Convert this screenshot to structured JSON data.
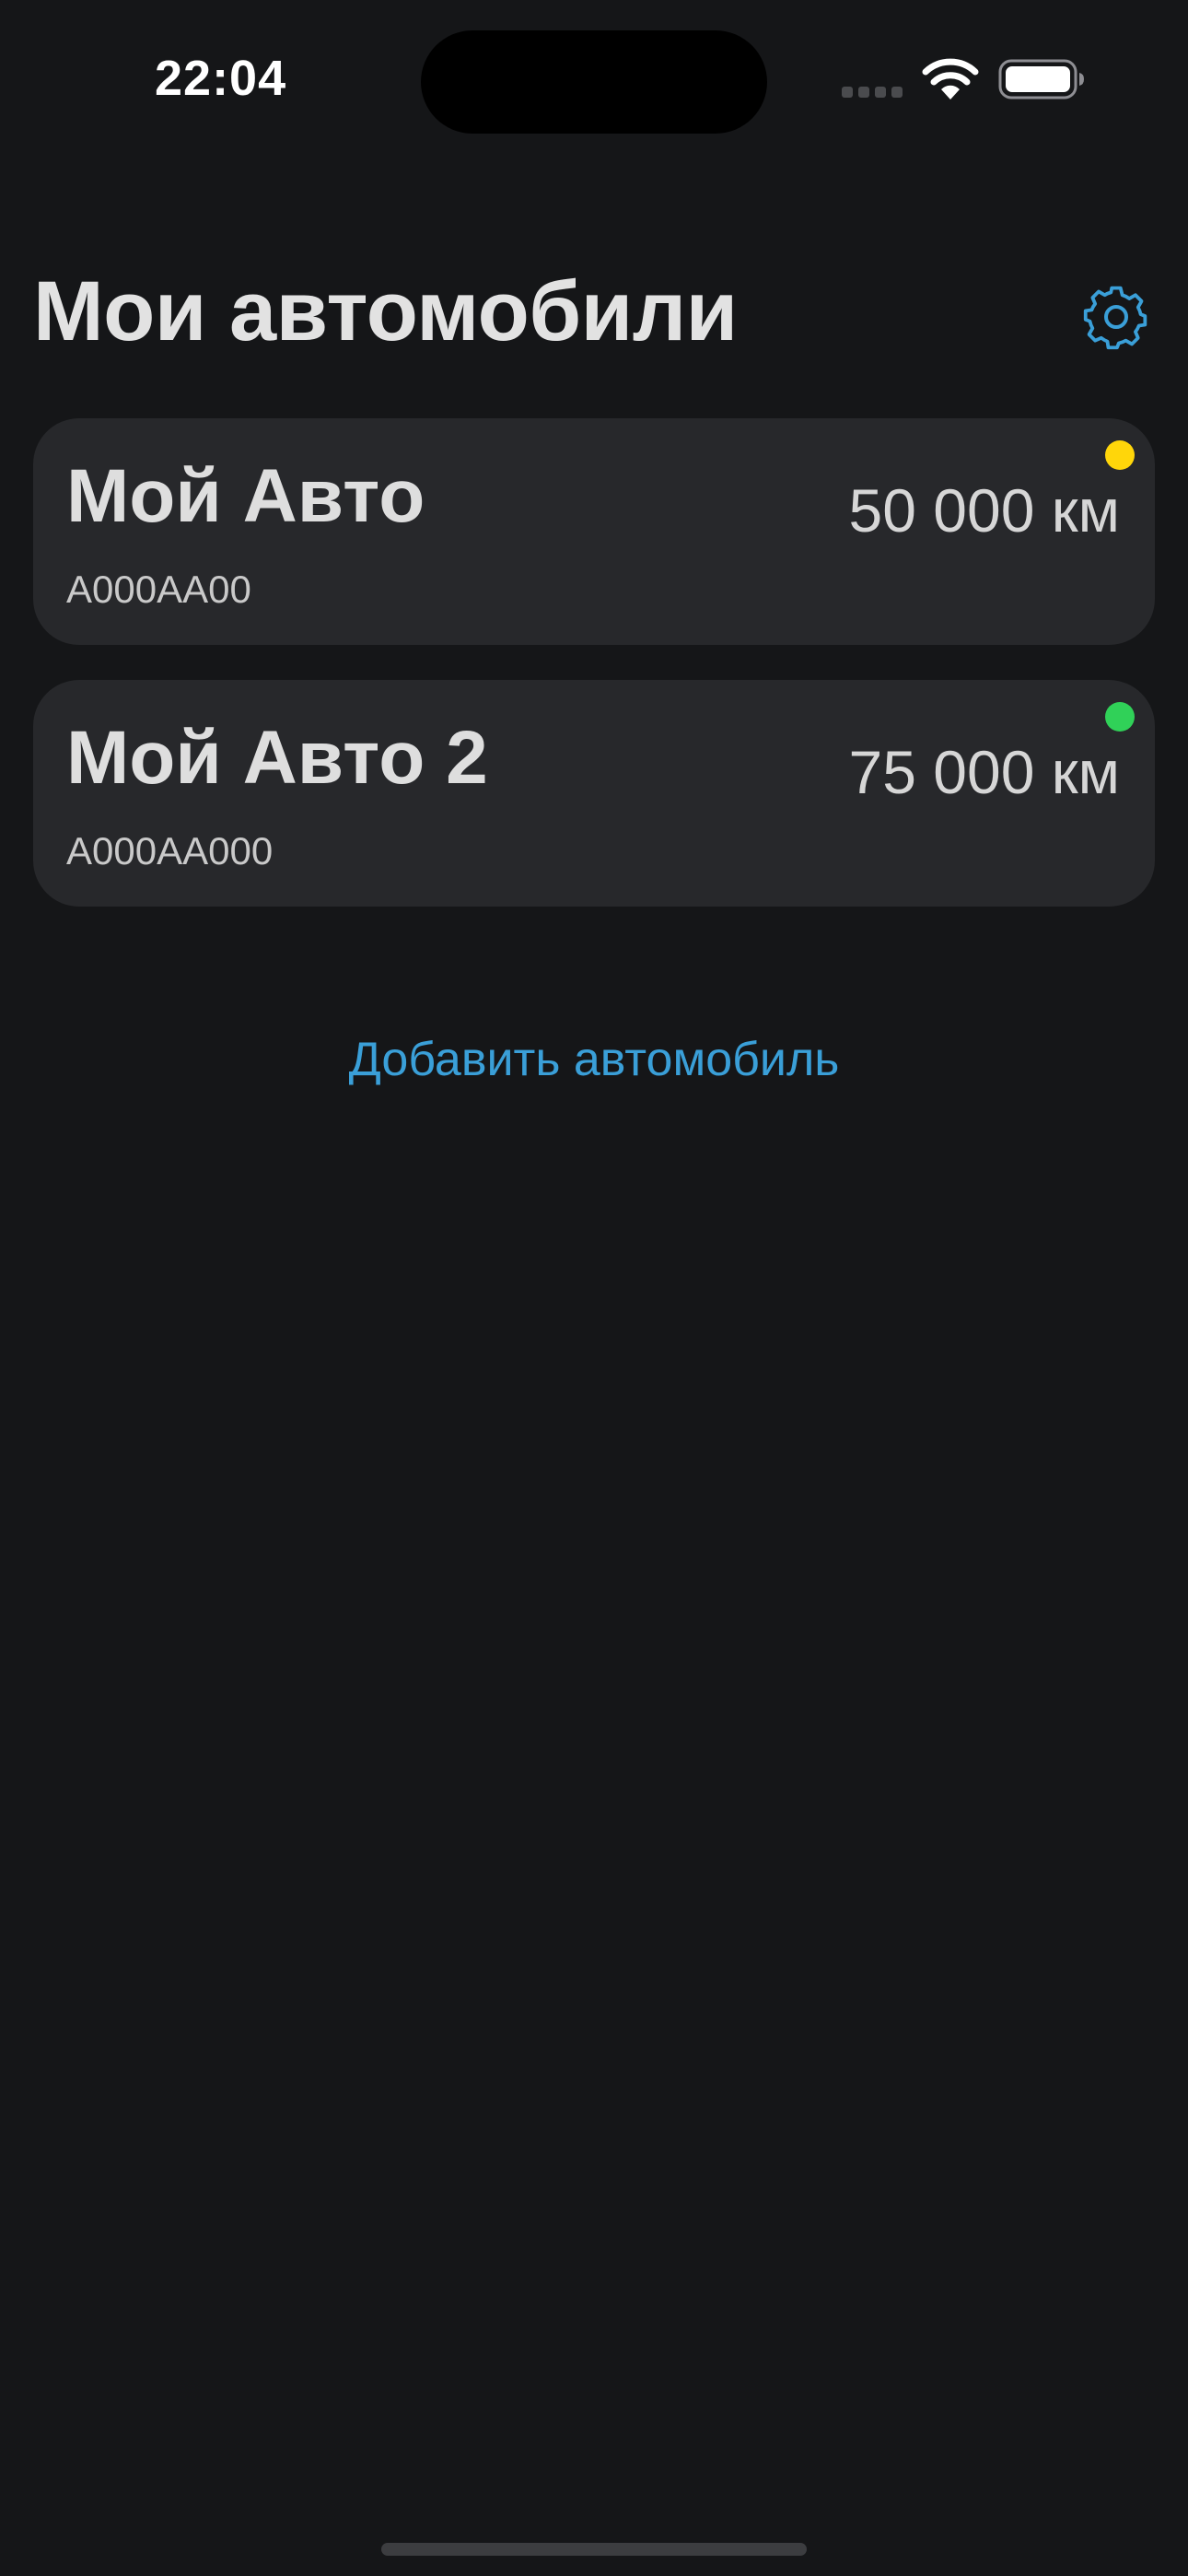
{
  "status_bar": {
    "time": "22:04"
  },
  "header": {
    "title": "Мои автомобили",
    "settings_icon": "gear-icon"
  },
  "cars": [
    {
      "name": "Мой Авто",
      "plate": "A000AA00",
      "mileage": "50 000 км",
      "status_color": "#ffd60a"
    },
    {
      "name": "Мой Авто 2",
      "plate": "A000AA000",
      "mileage": "75 000 км",
      "status_color": "#30d158"
    }
  ],
  "actions": {
    "add_car_label": "Добавить автомобиль"
  },
  "colors": {
    "accent": "#3a9fd8",
    "background": "#151618",
    "card": "#27282b"
  }
}
